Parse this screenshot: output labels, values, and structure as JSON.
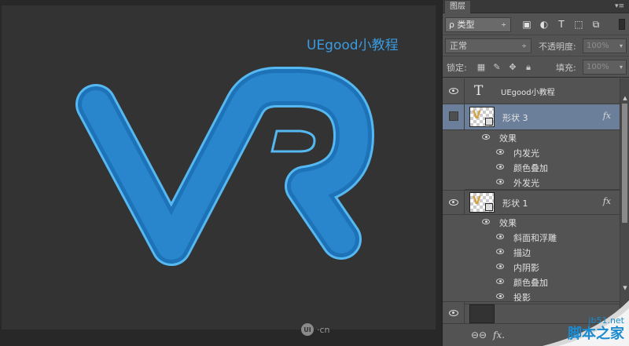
{
  "canvas": {
    "title": "UEgood小教程",
    "watermark_logo": "UI",
    "watermark_text": "·cn"
  },
  "panel": {
    "tab_label": "图层",
    "menu_glyph": "▾≡",
    "filter": {
      "label": "ρ 类型",
      "caret": "÷"
    },
    "blend": {
      "mode": "正常",
      "caret": "÷"
    },
    "opacity": {
      "label": "不透明度:",
      "value": "100%",
      "caret": "▾"
    },
    "lock": {
      "label": "锁定:"
    },
    "fill": {
      "label": "填充:",
      "value": "100%",
      "caret": "▾"
    }
  },
  "layers": [
    {
      "name": "UEgood小教程",
      "type": "text",
      "type_glyph": "T",
      "visible": true
    },
    {
      "name": "形状 3",
      "type": "shape",
      "visible": false,
      "selected": true,
      "fx": "fx",
      "effects_label": "效果",
      "effects": [
        "内发光",
        "颜色叠加",
        "外发光"
      ]
    },
    {
      "name": "形状 1",
      "type": "shape",
      "visible": true,
      "fx": "fx",
      "effects_label": "效果",
      "effects": [
        "斜面和浮雕",
        "描边",
        "内阴影",
        "颜色叠加",
        "投影"
      ]
    },
    {
      "name": "",
      "type": "background",
      "visible": true
    }
  ],
  "bottom_bar": {
    "link_glyph": "⊖⊖",
    "fx_glyph": "fx."
  },
  "corner_watermark": {
    "url": "jb51.net",
    "name": "脚本之家"
  },
  "colors": {
    "accent": "#3a9be0",
    "selected_layer": "#6b7f9a",
    "logo_fill": "#1f78c1",
    "logo_stroke": "#56b8f0"
  }
}
